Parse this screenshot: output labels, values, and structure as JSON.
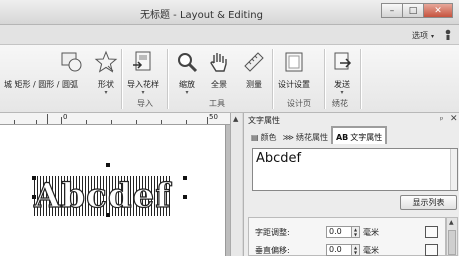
{
  "window": {
    "title": "无标题 - Layout & Editing",
    "minimize": "–",
    "maximize": "□",
    "close": "✕"
  },
  "menu": {
    "options": "选项",
    "options_arrow": "▾"
  },
  "ribbon": {
    "items": [
      {
        "label": "城 矩形 / 圆形 / 圆弧",
        "sub": ""
      },
      {
        "label": "形状",
        "sub": "▾"
      },
      {
        "label": "导入花样",
        "sub": "▾"
      },
      {
        "label": "缩放",
        "sub": "▾"
      },
      {
        "label": "全景",
        "sub": ""
      },
      {
        "label": "测量",
        "sub": ""
      },
      {
        "label": "设计设置",
        "sub": ""
      },
      {
        "label": "发送",
        "sub": "▾"
      }
    ],
    "groups": {
      "import": "导入",
      "tools": "工具",
      "design_page": "设计页",
      "embroider": "绣花"
    }
  },
  "ruler": {
    "labels": [
      "0",
      "50"
    ]
  },
  "canvas": {
    "text": "Abcdef"
  },
  "panel": {
    "title": "文字属性",
    "pin": "ᵖ",
    "close": "✕",
    "tabs": [
      {
        "icon": "▤",
        "label": "颜色"
      },
      {
        "icon": "⋙",
        "label": "绣花属性"
      },
      {
        "icon": "AB",
        "label": "文字属性"
      }
    ],
    "text_value": "Abcdef",
    "show_list": "显示列表",
    "properties": [
      {
        "label": "字距调整:",
        "value": "0.0",
        "unit": "毫米"
      },
      {
        "label": "垂直偏移:",
        "value": "0.0",
        "unit": "毫米"
      }
    ]
  },
  "colors": {
    "accent_close": "#c6533e"
  }
}
